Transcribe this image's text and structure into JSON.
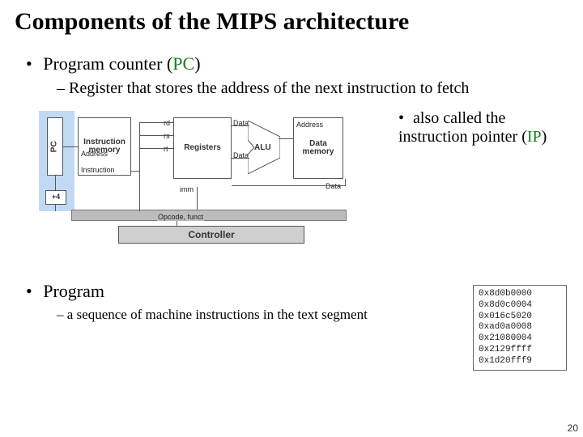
{
  "title": "Components of the MIPS architecture",
  "bullets": {
    "b1_prefix": "Program counter (",
    "b1_pc": "PC",
    "b1_suffix": ")",
    "b1_sub": "– Register that stores the address of the next instruction to fetch",
    "b1_note_prefix": "also called the instruction pointer (",
    "b1_note_ip": "IP",
    "b1_note_suffix": ")",
    "b2": "Program",
    "b2_sub": "–  a sequence of machine instructions in the text segment"
  },
  "diagram": {
    "pc": "PC",
    "plus4": "+4",
    "imem_l1": "Instruction",
    "imem_l2": "memory",
    "imem_addr": "Address",
    "imem_instr": "Instruction",
    "regs": "Registers",
    "reg_rd": "rd",
    "reg_rs": "rs",
    "reg_rt": "rt",
    "reg_imm": "imm",
    "regs_data1": "Data",
    "regs_data2": "Data",
    "alu": "ALU",
    "dmem_addr": "Address",
    "dmem_l1": "Data",
    "dmem_l2": "memory",
    "dmem_data": "Data",
    "controller": "Controller",
    "opcode": "Opcode, funct"
  },
  "code_lines": [
    "0x8d0b0000",
    "0x8d0c0004",
    "0x016c5020",
    "0xad0a0008",
    "0x21080004",
    "0x2129ffff",
    "0x1d20fff9"
  ],
  "page_number": "20"
}
